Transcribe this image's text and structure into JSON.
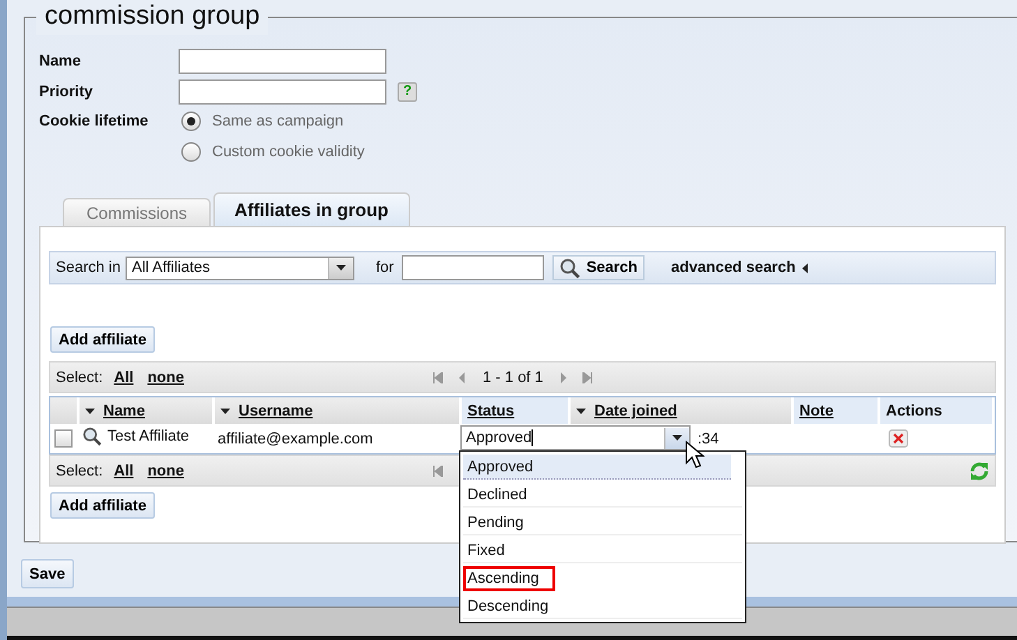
{
  "legend": "commission group",
  "fields": [
    {
      "label": "Name"
    },
    {
      "label": "Priority",
      "help": "?"
    }
  ],
  "cookie_lifetime": {
    "label": "Cookie lifetime",
    "options": [
      {
        "label": "Same as campaign",
        "selected": true
      },
      {
        "label": "Custom cookie validity",
        "selected": false
      }
    ]
  },
  "tabs": [
    {
      "label": "Commissions",
      "selected": false
    },
    {
      "label": "Affiliates in group",
      "selected": true
    }
  ],
  "search": {
    "label": "Search in",
    "scope": "All Affiliates",
    "for_label": "for",
    "button": "Search",
    "advanced": "advanced search"
  },
  "add_button": "Add affiliate",
  "select_bar": {
    "label": "Select:",
    "all": "All",
    "none": "none",
    "pager": "1 - 1 of 1"
  },
  "table": {
    "columns": [
      {
        "label": "Name",
        "sortable": true,
        "highlighted": false
      },
      {
        "label": "Username",
        "sortable": true,
        "highlighted": false
      },
      {
        "label": "Status",
        "sortable": false,
        "highlighted": true
      },
      {
        "label": "Date joined",
        "sortable": true,
        "highlighted": false
      },
      {
        "label": "Note",
        "sortable": false,
        "highlighted": true
      },
      {
        "label": "Actions",
        "sortable": false,
        "highlighted": true
      }
    ],
    "rows": [
      {
        "checked": false,
        "name": "Test Affiliate",
        "username": "affiliate@example.com",
        "status": "Approved",
        "date_joined": ":34"
      }
    ]
  },
  "bottom_bar": {
    "label": "Select:",
    "all": "All",
    "none": "none"
  },
  "bottom_add_button": "Add affiliate",
  "status_dropdown": [
    {
      "label": "Approved",
      "selected": true,
      "highlighted": false
    },
    {
      "label": "Declined",
      "selected": false,
      "highlighted": false
    },
    {
      "label": "Pending",
      "selected": false,
      "highlighted": false
    },
    {
      "label": "Fixed",
      "selected": false,
      "highlighted": false
    },
    {
      "label": "Ascending",
      "selected": false,
      "highlighted": true
    },
    {
      "label": "Descending",
      "selected": false,
      "highlighted": false
    }
  ],
  "save_button": "Save"
}
